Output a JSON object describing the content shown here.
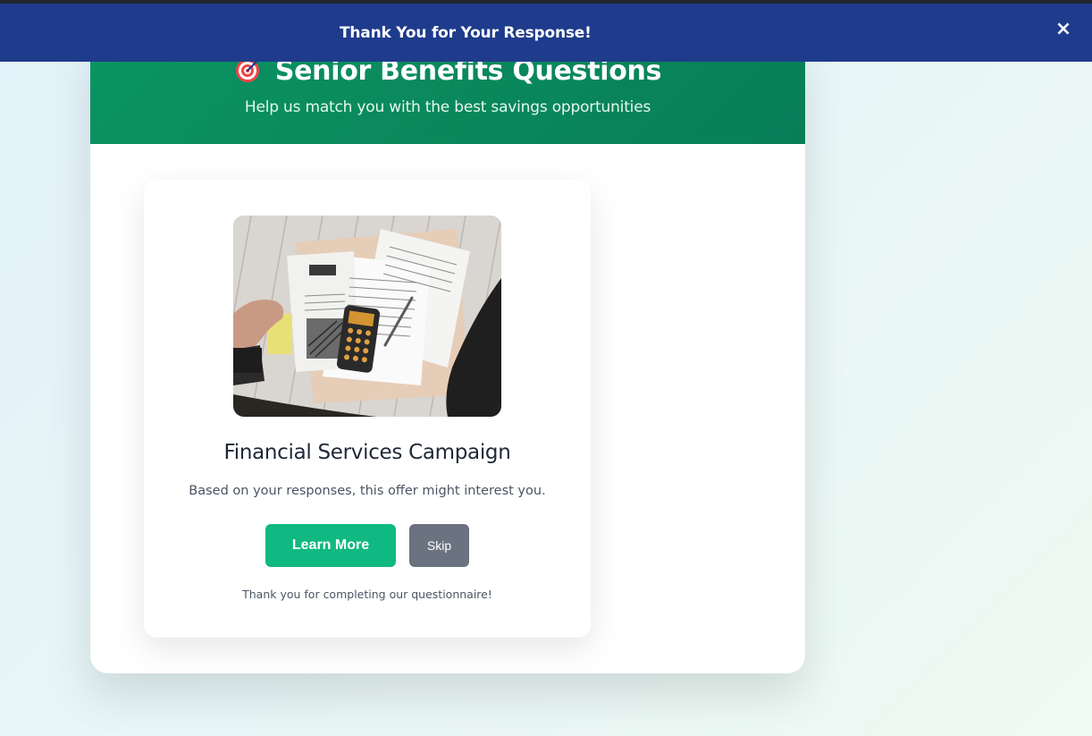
{
  "notification": {
    "message": "Thank You for Your Response!",
    "close_glyph": "×",
    "close_icon": "close-icon"
  },
  "header": {
    "icon": "target-icon",
    "title": "Senior Benefits Questions",
    "subtitle": "Help us match you with the best savings opportunities"
  },
  "offer": {
    "image": "tax-documents-calculator-photo",
    "title": "Financial Services Campaign",
    "description": "Based on your responses, this offer might interest you.",
    "learn_more_label": "Learn More",
    "skip_label": "Skip",
    "footer_text": "Thank you for completing our questionnaire!"
  },
  "colors": {
    "notification_bg": "#1f3b8c",
    "header_bg": "#0b9463",
    "primary_button": "#10b981",
    "secondary_button": "#6b7280",
    "page_bg": "#e8f6f7"
  }
}
